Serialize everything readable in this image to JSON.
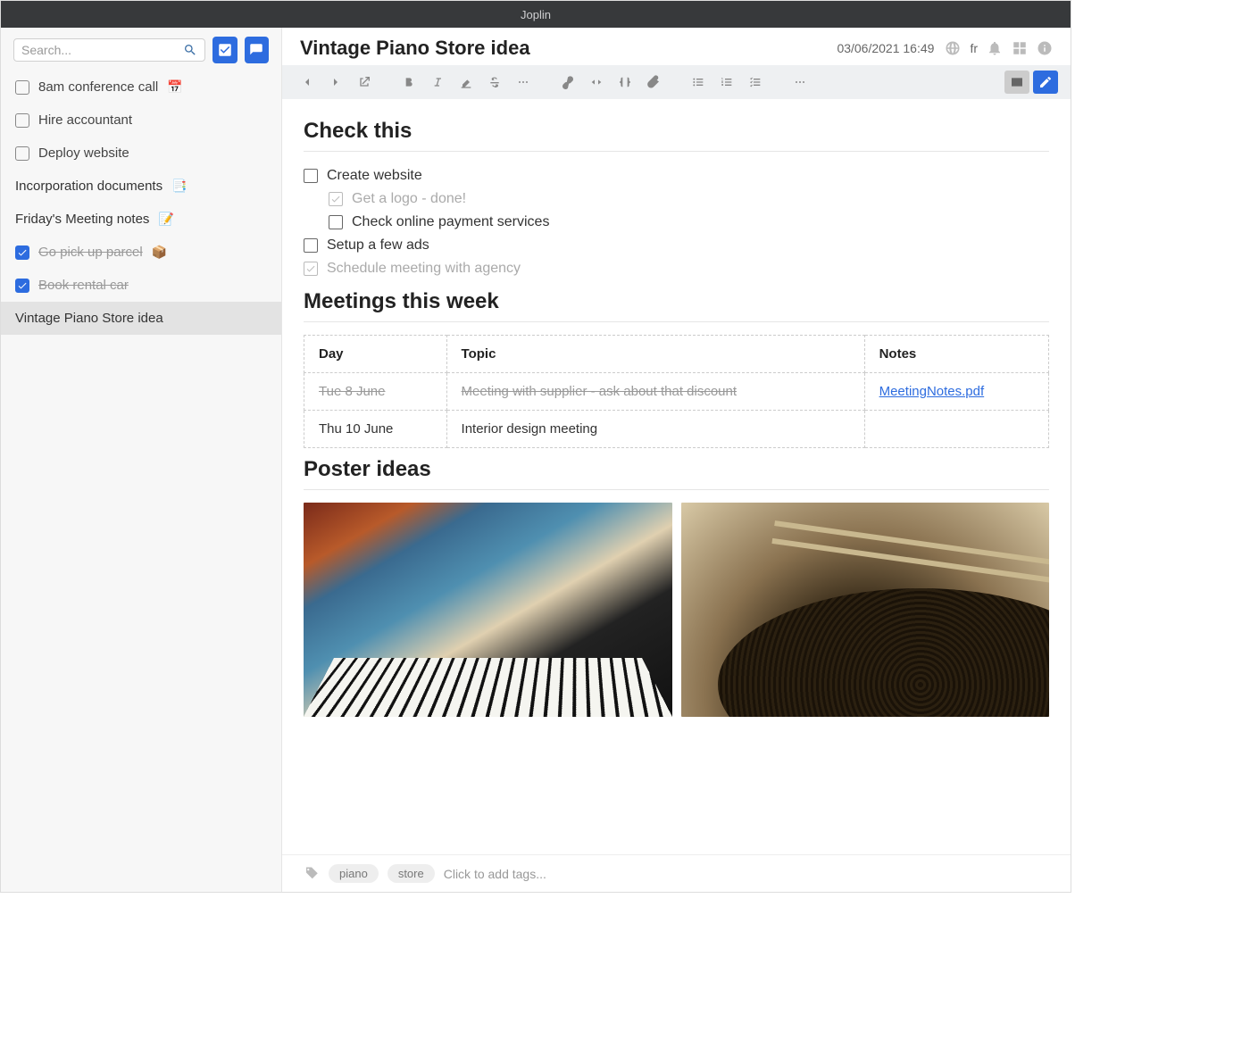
{
  "app": {
    "title": "Joplin"
  },
  "sidebar": {
    "search_placeholder": "Search...",
    "items": [
      {
        "label": "8am conference call",
        "emoji": "📅",
        "checked": false,
        "type": "todo"
      },
      {
        "label": "Hire accountant",
        "emoji": "",
        "checked": false,
        "type": "todo"
      },
      {
        "label": "Deploy website",
        "emoji": "",
        "checked": false,
        "type": "todo"
      },
      {
        "label": "Incorporation documents",
        "emoji": "📑",
        "type": "note"
      },
      {
        "label": "Friday's Meeting notes",
        "emoji": "📝",
        "type": "note"
      },
      {
        "label": "Go pick up parcel",
        "emoji": "📦",
        "checked": true,
        "type": "todo"
      },
      {
        "label": "Book rental car",
        "emoji": "",
        "checked": true,
        "type": "todo"
      },
      {
        "label": "Vintage Piano Store idea",
        "emoji": "",
        "type": "note",
        "selected": true
      }
    ]
  },
  "header": {
    "title": "Vintage Piano Store idea",
    "date": "03/06/2021 16:49",
    "lang": "fr"
  },
  "body": {
    "h1": "Check this",
    "checks": [
      {
        "label": "Create website",
        "done": false,
        "indent": 0
      },
      {
        "label": "Get a logo - done!",
        "done": true,
        "indent": 1
      },
      {
        "label": "Check online payment services",
        "done": false,
        "indent": 1
      },
      {
        "label": "Setup a few ads",
        "done": false,
        "indent": 0
      },
      {
        "label": "Schedule meeting with agency",
        "done": true,
        "indent": 0
      }
    ],
    "h2": "Meetings this week",
    "table": {
      "headers": [
        "Day",
        "Topic",
        "Notes"
      ],
      "rows": [
        {
          "day": "Tue 8 June",
          "topic": "Meeting with supplier - ask about that discount",
          "notes": "MeetingNotes.pdf",
          "struck": true,
          "link": true
        },
        {
          "day": "Thu 10 June",
          "topic": "Interior design meeting",
          "notes": "",
          "struck": false
        }
      ]
    },
    "h3": "Poster ideas"
  },
  "tags": {
    "items": [
      "piano",
      "store"
    ],
    "add_text": "Click to add tags..."
  }
}
